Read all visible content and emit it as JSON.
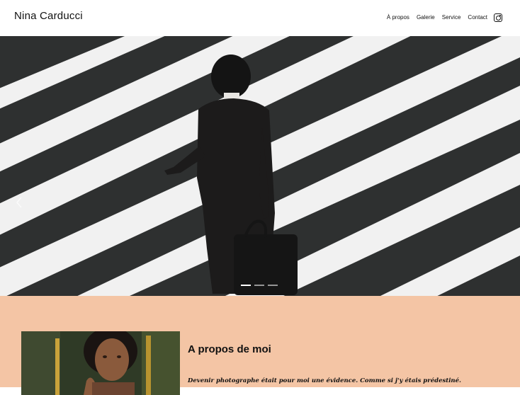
{
  "header": {
    "site_title": "Nina Carducci",
    "nav": [
      "À propos",
      "Galerie",
      "Service",
      "Contact"
    ],
    "social_icon": "instagram-icon"
  },
  "hero": {
    "image": "man in suit walking across zebra crossing with bag",
    "carousel_dots": 3,
    "active_dot": 1
  },
  "about": {
    "title": "A propos de moi",
    "quote": "Devenir photographe était pour moi une évidence. Comme si j'y étais prédestiné."
  },
  "colors": {
    "about_bg": "#f4c5a5",
    "stripe_dark": "#2e3030",
    "stripe_light": "#f1f1f1"
  }
}
